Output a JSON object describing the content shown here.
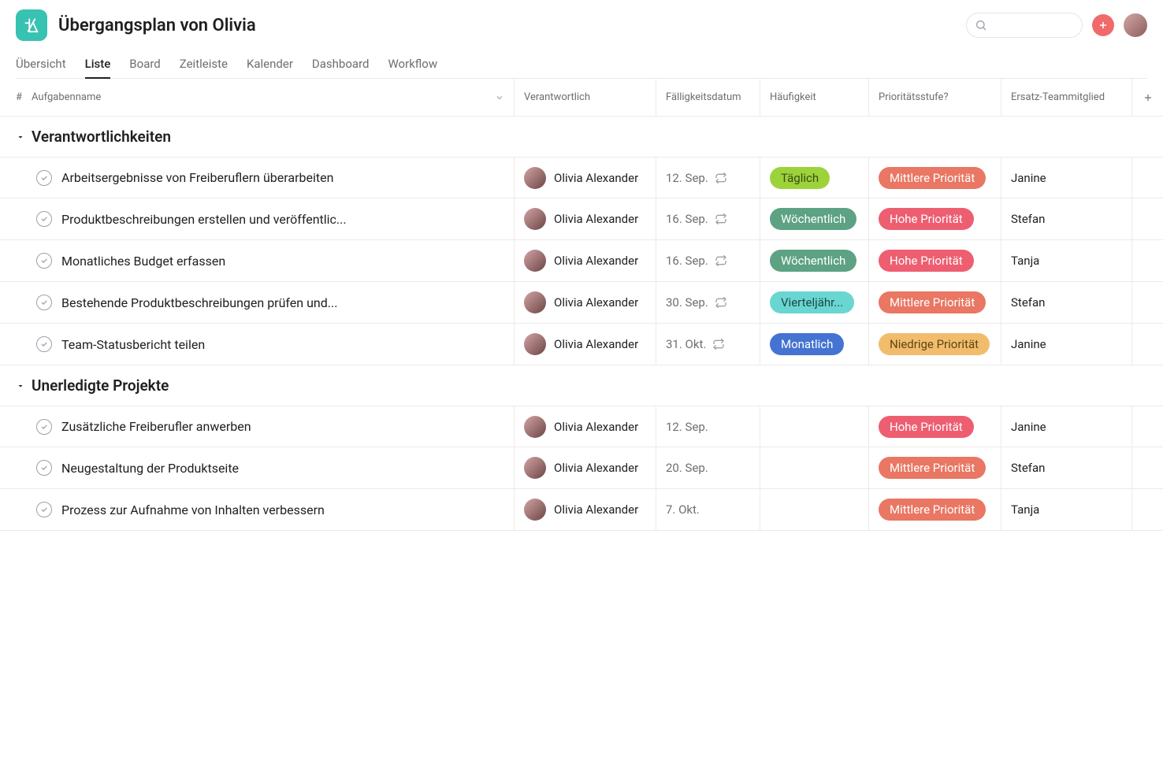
{
  "project": {
    "title": "Übergangsplan von Olivia"
  },
  "tabs": [
    {
      "label": "Übersicht"
    },
    {
      "label": "Liste"
    },
    {
      "label": "Board"
    },
    {
      "label": "Zeitleiste"
    },
    {
      "label": "Kalender"
    },
    {
      "label": "Dashboard"
    },
    {
      "label": "Workflow"
    }
  ],
  "columns": {
    "num": "#",
    "name": "Aufgabenname",
    "assignee": "Verantwortlich",
    "due": "Fälligkeitsdatum",
    "freq": "Häufigkeit",
    "priority": "Prioritätsstufe?",
    "backup": "Ersatz-Teammitglied"
  },
  "sections": [
    {
      "title": "Verantwortlichkeiten",
      "tasks": [
        {
          "name": "Arbeitsergebnisse von Freiberuflern überarbeiten",
          "assignee": "Olivia Alexander",
          "due": "12. Sep.",
          "recurring": true,
          "freq": "Täglich",
          "freqClass": "pill-daily",
          "priority": "Mittlere Priorität",
          "priClass": "pill-mid",
          "backup": "Janine"
        },
        {
          "name": "Produktbeschreibungen erstellen und veröffentlic...",
          "assignee": "Olivia Alexander",
          "due": "16. Sep.",
          "recurring": true,
          "freq": "Wöchentlich",
          "freqClass": "pill-weekly",
          "priority": "Hohe Priorität",
          "priClass": "pill-high",
          "backup": "Stefan"
        },
        {
          "name": "Monatliches Budget erfassen",
          "assignee": "Olivia Alexander",
          "due": "16. Sep.",
          "recurring": true,
          "freq": "Wöchentlich",
          "freqClass": "pill-weekly",
          "priority": "Hohe Priorität",
          "priClass": "pill-high",
          "backup": "Tanja"
        },
        {
          "name": "Bestehende Produktbeschreibungen prüfen und...",
          "assignee": "Olivia Alexander",
          "due": "30. Sep.",
          "recurring": true,
          "freq": "Vierteljähr...",
          "freqClass": "pill-quarterly",
          "priority": "Mittlere Priorität",
          "priClass": "pill-mid",
          "backup": "Stefan"
        },
        {
          "name": "Team-Statusbericht teilen",
          "assignee": "Olivia Alexander",
          "due": "31. Okt.",
          "recurring": true,
          "freq": "Monatlich",
          "freqClass": "pill-monthly",
          "priority": "Niedrige Priorität",
          "priClass": "pill-low",
          "backup": "Janine"
        }
      ]
    },
    {
      "title": "Unerledigte Projekte",
      "tasks": [
        {
          "name": "Zusätzliche Freiberufler anwerben",
          "assignee": "Olivia Alexander",
          "due": "12. Sep.",
          "recurring": false,
          "freq": "",
          "freqClass": "",
          "priority": "Hohe Priorität",
          "priClass": "pill-high",
          "backup": "Janine"
        },
        {
          "name": "Neugestaltung der Produktseite",
          "assignee": "Olivia Alexander",
          "due": "20. Sep.",
          "recurring": false,
          "freq": "",
          "freqClass": "",
          "priority": "Mittlere Priorität",
          "priClass": "pill-mid",
          "backup": "Stefan"
        },
        {
          "name": "Prozess zur Aufnahme von Inhalten verbessern",
          "assignee": "Olivia Alexander",
          "due": "7. Okt.",
          "recurring": false,
          "freq": "",
          "freqClass": "",
          "priority": "Mittlere Priorität",
          "priClass": "pill-mid",
          "backup": "Tanja"
        }
      ]
    }
  ]
}
